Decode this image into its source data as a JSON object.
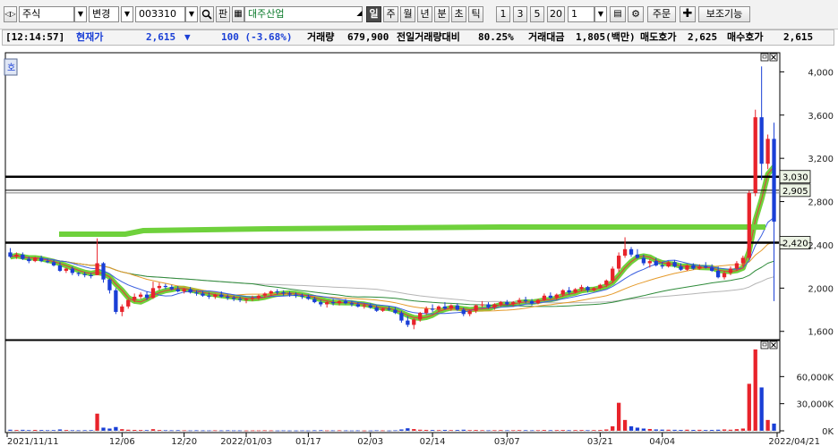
{
  "toolbar": {
    "market": "주식",
    "change_label": "변경",
    "code": "003310",
    "pan_label": "판",
    "company": "대주산업",
    "periods": [
      "일",
      "주",
      "월",
      "년",
      "분",
      "초",
      "틱"
    ],
    "selected_period": "일",
    "intervals": [
      "1",
      "3",
      "5",
      "20"
    ],
    "interval_value": "1",
    "order_label": "주문",
    "aux_label": "보조기능"
  },
  "info": {
    "time": "[12:14:57]",
    "current_label": "현재가",
    "current_price": "2,615",
    "change_arrow": "▼",
    "change": "100 (-3.68%)",
    "volume_label": "거래량",
    "volume": "679,900",
    "prev_ratio_label": "전일거래량대비",
    "prev_ratio": "80.25%",
    "amount_label": "거래대금",
    "amount": "1,805(백만)",
    "ask_label": "매도호가",
    "ask": "2,625",
    "bid_label": "매수호가",
    "bid": "2,615"
  },
  "chart_data": [
    {
      "type": "candlestick",
      "price_axis_ticks": [
        "4,000",
        "3,600",
        "3,200",
        "2,800",
        "2,400",
        "2,000",
        "1,600"
      ],
      "ylim": [
        1540,
        4160
      ],
      "date_ticks": [
        "2021/11/11",
        "12/06",
        "12/20",
        "2022/01/03",
        "01/17",
        "02/03",
        "02/14",
        "03/07",
        "03/21",
        "04/04",
        "2022/04/21"
      ],
      "horizontal_lines": [
        {
          "label": "3,030",
          "value": 3030,
          "color": "#000000"
        },
        {
          "label": "2,905",
          "value": 2905,
          "color": "#000000"
        },
        {
          "label": "2,420",
          "value": 2420,
          "color": "#000000"
        }
      ],
      "candles": [
        [
          2330,
          2370,
          2280,
          2290
        ],
        [
          2290,
          2330,
          2270,
          2310
        ],
        [
          2310,
          2330,
          2260,
          2270
        ],
        [
          2270,
          2290,
          2230,
          2250
        ],
        [
          2250,
          2290,
          2240,
          2280
        ],
        [
          2280,
          2300,
          2240,
          2250
        ],
        [
          2250,
          2270,
          2230,
          2240
        ],
        [
          2240,
          2260,
          2200,
          2210
        ],
        [
          2210,
          2240,
          2150,
          2160
        ],
        [
          2160,
          2190,
          2140,
          2180
        ],
        [
          2180,
          2200,
          2120,
          2140
        ],
        [
          2140,
          2150,
          2110,
          2130
        ],
        [
          2130,
          2150,
          2100,
          2120
        ],
        [
          2120,
          2140,
          2090,
          2110
        ],
        [
          2120,
          2460,
          2120,
          2230
        ],
        [
          2230,
          2240,
          2050,
          2080
        ],
        [
          2080,
          2090,
          1950,
          1980
        ],
        [
          1980,
          2000,
          1760,
          1780
        ],
        [
          1780,
          1850,
          1740,
          1830
        ],
        [
          1830,
          1900,
          1810,
          1890
        ],
        [
          1890,
          1950,
          1870,
          1920
        ],
        [
          1920,
          1960,
          1900,
          1940
        ],
        [
          1940,
          1970,
          1890,
          1910
        ],
        [
          1910,
          2060,
          1900,
          2000
        ],
        [
          2000,
          2050,
          1980,
          2020
        ],
        [
          2020,
          2040,
          1990,
          2010
        ],
        [
          2010,
          2030,
          1980,
          1990
        ],
        [
          1990,
          2020,
          1960,
          1970
        ],
        [
          1970,
          2000,
          1950,
          1990
        ],
        [
          1990,
          2010,
          1950,
          1960
        ],
        [
          1960,
          1980,
          1930,
          1950
        ],
        [
          1950,
          1970,
          1920,
          1930
        ],
        [
          1930,
          1960,
          1900,
          1920
        ],
        [
          1920,
          1950,
          1900,
          1940
        ],
        [
          1940,
          1970,
          1910,
          1920
        ],
        [
          1920,
          1940,
          1890,
          1910
        ],
        [
          1910,
          1930,
          1880,
          1900
        ],
        [
          1900,
          1920,
          1870,
          1890
        ],
        [
          1890,
          1910,
          1860,
          1900
        ],
        [
          1900,
          1930,
          1880,
          1910
        ],
        [
          1910,
          1940,
          1890,
          1930
        ],
        [
          1930,
          1960,
          1910,
          1950
        ],
        [
          1950,
          1980,
          1930,
          1970
        ],
        [
          1970,
          1990,
          1940,
          1960
        ],
        [
          1960,
          1980,
          1930,
          1950
        ],
        [
          1950,
          1970,
          1920,
          1940
        ],
        [
          1940,
          1960,
          1910,
          1930
        ],
        [
          1930,
          1950,
          1900,
          1920
        ],
        [
          1920,
          1940,
          1890,
          1900
        ],
        [
          1900,
          1920,
          1860,
          1870
        ],
        [
          1870,
          1890,
          1830,
          1850
        ],
        [
          1850,
          1880,
          1820,
          1870
        ],
        [
          1870,
          1900,
          1840,
          1860
        ],
        [
          1860,
          1890,
          1840,
          1880
        ],
        [
          1880,
          1900,
          1850,
          1860
        ],
        [
          1860,
          1880,
          1830,
          1850
        ],
        [
          1850,
          1870,
          1820,
          1830
        ],
        [
          1830,
          1860,
          1810,
          1840
        ],
        [
          1840,
          1860,
          1810,
          1820
        ],
        [
          1820,
          1840,
          1780,
          1790
        ],
        [
          1790,
          1820,
          1780,
          1810
        ],
        [
          1810,
          1830,
          1790,
          1800
        ],
        [
          1800,
          1820,
          1760,
          1770
        ],
        [
          1770,
          1790,
          1680,
          1700
        ],
        [
          1700,
          1740,
          1640,
          1660
        ],
        [
          1660,
          1720,
          1620,
          1710
        ],
        [
          1710,
          1780,
          1690,
          1770
        ],
        [
          1770,
          1830,
          1750,
          1810
        ],
        [
          1810,
          1850,
          1780,
          1800
        ],
        [
          1800,
          1840,
          1780,
          1830
        ],
        [
          1830,
          1870,
          1800,
          1810
        ],
        [
          1810,
          1850,
          1790,
          1840
        ],
        [
          1840,
          1860,
          1790,
          1800
        ],
        [
          1800,
          1820,
          1740,
          1760
        ],
        [
          1760,
          1800,
          1740,
          1790
        ],
        [
          1790,
          1850,
          1770,
          1840
        ],
        [
          1840,
          1880,
          1820,
          1850
        ],
        [
          1850,
          1870,
          1810,
          1820
        ],
        [
          1820,
          1860,
          1800,
          1850
        ],
        [
          1850,
          1880,
          1830,
          1870
        ],
        [
          1870,
          1890,
          1840,
          1850
        ],
        [
          1850,
          1880,
          1830,
          1870
        ],
        [
          1870,
          1910,
          1850,
          1890
        ],
        [
          1890,
          1920,
          1860,
          1880
        ],
        [
          1880,
          1900,
          1840,
          1860
        ],
        [
          1860,
          1900,
          1850,
          1890
        ],
        [
          1890,
          1950,
          1880,
          1930
        ],
        [
          1930,
          1960,
          1900,
          1910
        ],
        [
          1910,
          1950,
          1890,
          1940
        ],
        [
          1940,
          1990,
          1920,
          1980
        ],
        [
          1980,
          2010,
          1940,
          1960
        ],
        [
          1960,
          2000,
          1950,
          1990
        ],
        [
          1990,
          2030,
          1970,
          2010
        ],
        [
          2010,
          2020,
          1960,
          1980
        ],
        [
          1980,
          2010,
          1970,
          2000
        ],
        [
          2000,
          2040,
          1990,
          2030
        ],
        [
          2030,
          2080,
          2010,
          2070
        ],
        [
          2070,
          2200,
          2050,
          2180
        ],
        [
          2180,
          2330,
          2150,
          2300
        ],
        [
          2300,
          2470,
          2280,
          2360
        ],
        [
          2360,
          2380,
          2290,
          2310
        ],
        [
          2310,
          2360,
          2270,
          2280
        ],
        [
          2280,
          2310,
          2210,
          2230
        ],
        [
          2230,
          2270,
          2190,
          2250
        ],
        [
          2250,
          2280,
          2200,
          2210
        ],
        [
          2210,
          2240,
          2180,
          2200
        ],
        [
          2200,
          2250,
          2190,
          2240
        ],
        [
          2240,
          2260,
          2190,
          2200
        ],
        [
          2200,
          2230,
          2160,
          2170
        ],
        [
          2170,
          2220,
          2160,
          2210
        ],
        [
          2210,
          2230,
          2170,
          2180
        ],
        [
          2180,
          2220,
          2170,
          2200
        ],
        [
          2200,
          2240,
          2180,
          2190
        ],
        [
          2190,
          2220,
          2150,
          2160
        ],
        [
          2160,
          2200,
          2090,
          2100
        ],
        [
          2100,
          2160,
          2080,
          2140
        ],
        [
          2140,
          2200,
          2120,
          2180
        ],
        [
          2180,
          2250,
          2160,
          2230
        ],
        [
          2230,
          2300,
          2200,
          2280
        ],
        [
          2280,
          2900,
          2260,
          2880
        ],
        [
          2880,
          3650,
          2850,
          3580
        ],
        [
          3580,
          4050,
          3000,
          3150
        ],
        [
          3150,
          3420,
          3100,
          3380
        ],
        [
          3380,
          3530,
          1880,
          2615
        ]
      ],
      "volume_axis_ticks": [
        "60,000K",
        "30,000K",
        "0K"
      ],
      "volume_ylim": [
        0,
        90000
      ],
      "volumes": [
        1200,
        900,
        1100,
        800,
        1000,
        900,
        700,
        800,
        1500,
        900,
        700,
        600,
        700,
        800,
        19000,
        3500,
        2500,
        4200,
        1800,
        1200,
        1000,
        900,
        800,
        1800,
        900,
        700,
        600,
        700,
        600,
        500,
        600,
        500,
        500,
        600,
        500,
        600,
        500,
        500,
        400,
        500,
        500,
        600,
        500,
        400,
        500,
        400,
        400,
        500,
        400,
        600,
        700,
        500,
        500,
        600,
        500,
        400,
        500,
        400,
        400,
        600,
        500,
        400,
        600,
        1500,
        2800,
        1900,
        1200,
        1000,
        900,
        800,
        1000,
        800,
        900,
        1200,
        800,
        900,
        700,
        600,
        700,
        800,
        600,
        700,
        800,
        700,
        600,
        700,
        900,
        700,
        800,
        900,
        700,
        800,
        900,
        700,
        800,
        900,
        1500,
        5000,
        31000,
        12000,
        5000,
        3500,
        2500,
        2000,
        1500,
        1300,
        1200,
        1100,
        1000,
        1200,
        1000,
        1100,
        900,
        1000,
        1200,
        1500,
        1200,
        1800,
        2500,
        52000,
        90000,
        48000,
        12000,
        8000
      ]
    }
  ]
}
